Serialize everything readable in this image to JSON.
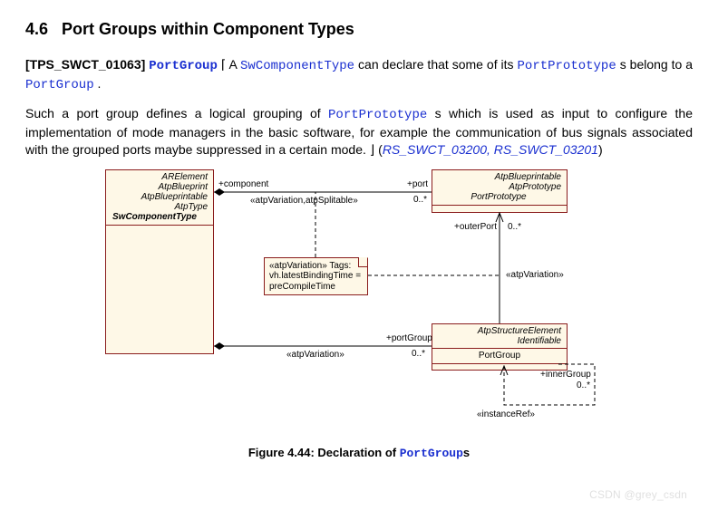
{
  "section": {
    "number": "4.6",
    "title": "Port Groups within Component Types"
  },
  "req": {
    "id": "[TPS_SWCT_01063]",
    "name": "PortGroup"
  },
  "p1": {
    "t1": "A ",
    "code1": "SwComponentType",
    "t2": " can declare that some of its ",
    "code2": "PortPrototype",
    "t3": "s belong to a ",
    "code3": "PortGroup",
    "t4": "."
  },
  "p2": {
    "t1": "Such a port group defines a logical grouping of ",
    "code1": "PortPrototype",
    "t2": "s which is used as input to configure the implementation of mode managers in the basic software, for example the communication of bus signals associated with the grouped ports maybe suppressed in a certain mode. ",
    "ref1": "RS_SWCT_03200",
    "sep": ", ",
    "ref2": "RS_SWCT_03201"
  },
  "diagram": {
    "class_swc": {
      "stereos": [
        "ARElement",
        "AtpBlueprint",
        "AtpBlueprintable",
        "AtpType"
      ],
      "name": "SwComponentType"
    },
    "class_port": {
      "stereos": [
        "AtpBlueprintable",
        "AtpPrototype"
      ],
      "name": "PortPrototype"
    },
    "class_pg": {
      "stereos": [
        "AtpStructureElement",
        "Identifiable"
      ],
      "name": "PortGroup"
    },
    "note": {
      "line1": "«atpVariation» Tags:",
      "line2": "vh.latestBindingTime =",
      "line3": "preCompileTime"
    },
    "labels": {
      "component": "+component",
      "port": "+port",
      "port_mult": "0..*",
      "varsplit": "«atpVariation,atpSplitable»",
      "outerPort": "+outerPort",
      "outerPort_mult": "0..*",
      "atpvar": "«atpVariation»",
      "portGroup": "+portGroup",
      "portGroup_mult": "0..*",
      "innerGroup": "+innerGroup",
      "innerGroup_mult": "0..*",
      "instanceRef": "«instanceRef»"
    }
  },
  "caption": {
    "pre": "Figure 4.44: Declaration of ",
    "code": "PortGroup",
    "post": "s"
  },
  "watermark": "CSDN @grey_csdn"
}
